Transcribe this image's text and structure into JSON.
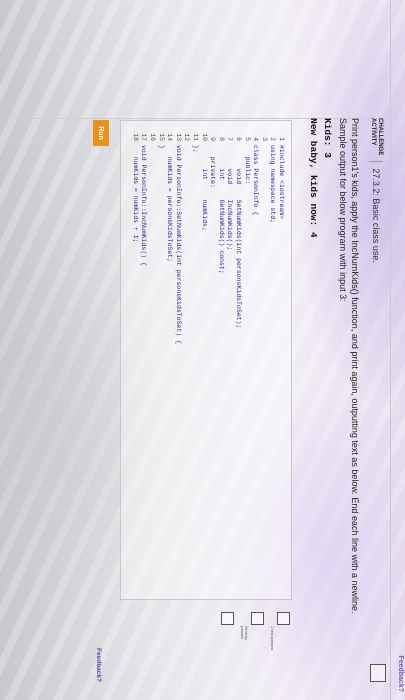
{
  "header": {
    "feedback_top": "Feedback?",
    "activity_label_line1": "CHALLENGE",
    "activity_label_line2": "ACTIVITY",
    "activity_title": "27.3.2: Basic class use."
  },
  "instructions": {
    "text": "Print person1's kids, apply the IncNumKids() function, and print again, outputting text as below. End each line with a newline.",
    "sample_intro": "Sample output for below program with input 3:",
    "sample_line1": "Kids: 3",
    "sample_line2": "New baby, kids now: 4"
  },
  "code": [
    {
      "n": "1",
      "t": "#include <iostream>"
    },
    {
      "n": "2",
      "t": "using namespace std;"
    },
    {
      "n": "3",
      "t": ""
    },
    {
      "n": "4",
      "t": "class PersonInfo {"
    },
    {
      "n": "5",
      "t": "   public:"
    },
    {
      "n": "6",
      "t": "      void    SetNumKids(int personsKidsToSet);"
    },
    {
      "n": "7",
      "t": "      void    IncNumKids();"
    },
    {
      "n": "8",
      "t": "      int     GetNumKids() const;"
    },
    {
      "n": "9",
      "t": "   private:"
    },
    {
      "n": "10",
      "t": "      int     numKids;"
    },
    {
      "n": "11",
      "t": "};"
    },
    {
      "n": "12",
      "t": ""
    },
    {
      "n": "13",
      "t": "void PersonInfo::SetNumKids(int personsKidsToSet) {"
    },
    {
      "n": "14",
      "t": "   numKids = personsKidsToSet;"
    },
    {
      "n": "15",
      "t": "}"
    },
    {
      "n": "16",
      "t": ""
    },
    {
      "n": "17",
      "t": "void PersonInfo::IncNumKids() {"
    },
    {
      "n": "18",
      "t": "   numKids = numKids + 1;"
    }
  ],
  "side": {
    "label1": "1 test passed",
    "label2": "All tests passed"
  },
  "run_label": "Run",
  "feedback_bottom": "Feedback?",
  "colors": {
    "run": "#e8911c",
    "code": "#2a2a8a"
  }
}
